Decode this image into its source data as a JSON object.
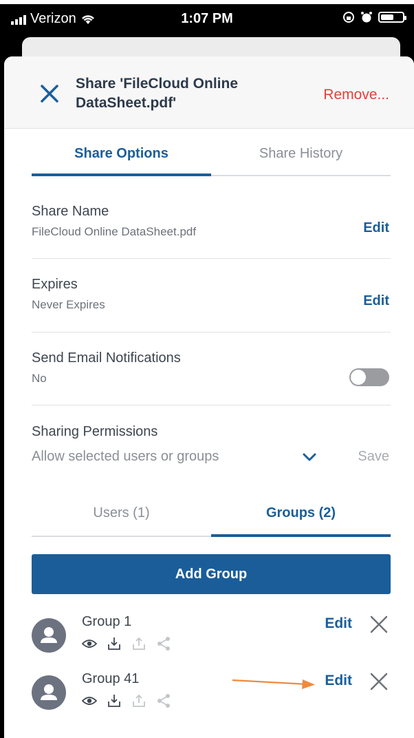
{
  "status_bar": {
    "carrier": "Verizon",
    "time": "1:07 PM"
  },
  "header": {
    "title": "Share 'FileCloud Online DataSheet.pdf'",
    "remove_label": "Remove..."
  },
  "tabs": [
    {
      "label": "Share Options",
      "active": true
    },
    {
      "label": "Share History",
      "active": false
    }
  ],
  "share_name": {
    "label": "Share Name",
    "value": "FileCloud Online DataSheet.pdf",
    "action": "Edit"
  },
  "expires": {
    "label": "Expires",
    "value": "Never Expires",
    "action": "Edit"
  },
  "email_notifications": {
    "label": "Send Email Notifications",
    "value": "No",
    "enabled": false
  },
  "sharing_permissions": {
    "label": "Sharing Permissions",
    "selected": "Allow selected users or groups",
    "save_label": "Save"
  },
  "sub_tabs": [
    {
      "label": "Users (1)",
      "active": false
    },
    {
      "label": "Groups (2)",
      "active": true
    }
  ],
  "add_group_label": "Add Group",
  "groups": [
    {
      "name": "Group 1",
      "edit_label": "Edit"
    },
    {
      "name": "Group 41",
      "edit_label": "Edit"
    }
  ],
  "colors": {
    "accent": "#1b5e9a",
    "button": "#1a5d99",
    "danger": "#e0423a",
    "annotation_arrow": "#f08a3c"
  }
}
